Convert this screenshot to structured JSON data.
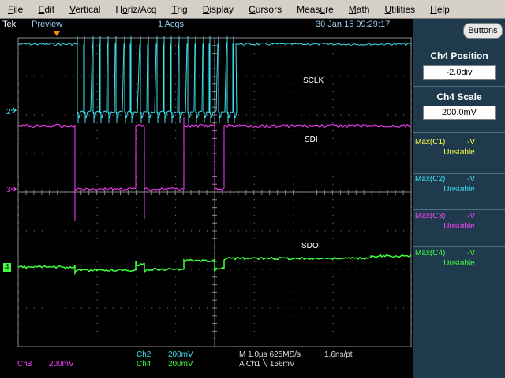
{
  "menu": {
    "items": [
      {
        "pre": "",
        "u": "F",
        "post": "ile"
      },
      {
        "pre": "",
        "u": "E",
        "post": "dit"
      },
      {
        "pre": "",
        "u": "V",
        "post": "ertical"
      },
      {
        "pre": "H",
        "u": "o",
        "post": "riz/Acq"
      },
      {
        "pre": "",
        "u": "T",
        "post": "rig"
      },
      {
        "pre": "",
        "u": "D",
        "post": "isplay"
      },
      {
        "pre": "",
        "u": "C",
        "post": "ursors"
      },
      {
        "pre": "Meas",
        "u": "u",
        "post": "re"
      },
      {
        "pre": "",
        "u": "M",
        "post": "ath"
      },
      {
        "pre": "",
        "u": "U",
        "post": "tilities"
      },
      {
        "pre": "",
        "u": "H",
        "post": "elp"
      }
    ]
  },
  "status": {
    "brand": "Tek",
    "mode": "Preview",
    "acqs": "1 Acqs",
    "datetime": "30 Jan 15 09:29:17"
  },
  "traces": {
    "sclk_label": "SCLK",
    "sdi_label": "SDI",
    "sdo_label": "SDO",
    "markers": {
      "ch2": "2",
      "ch3": "3",
      "ch4": "4"
    }
  },
  "panel": {
    "buttons_label": "Buttons",
    "position_title": "Ch4 Position",
    "position_value": "-2.0div",
    "scale_title": "Ch4 Scale",
    "scale_value": "200.0mV",
    "measurements": [
      {
        "label": "Max(C1)",
        "value": "-V",
        "status": "Unstable",
        "color": "#ffff40"
      },
      {
        "label": "Max(C2)",
        "value": "-V",
        "status": "Unstable",
        "color": "#40e0f0"
      },
      {
        "label": "Max(C3)",
        "value": "-V",
        "status": "Unstable",
        "color": "#ff40ff"
      },
      {
        "label": "Max(C4)",
        "value": "-V",
        "status": "Unstable",
        "color": "#40ff40"
      }
    ]
  },
  "readout": {
    "ch2_name": "Ch2",
    "ch2_scale": "200mV",
    "ch4_name": "Ch4",
    "ch4_scale": "200mV",
    "ch3_name": "Ch3",
    "ch3_scale": "200mV",
    "timebase": "M 1.0µs 625MS/s",
    "resolution": "1.6ns/pt",
    "trigger": "A  Ch1  ╲  156mV"
  },
  "colors": {
    "ch2": "#40e0f0",
    "ch3": "#ff40ff",
    "ch4": "#40ff40",
    "grid": "#8a8a8a"
  }
}
